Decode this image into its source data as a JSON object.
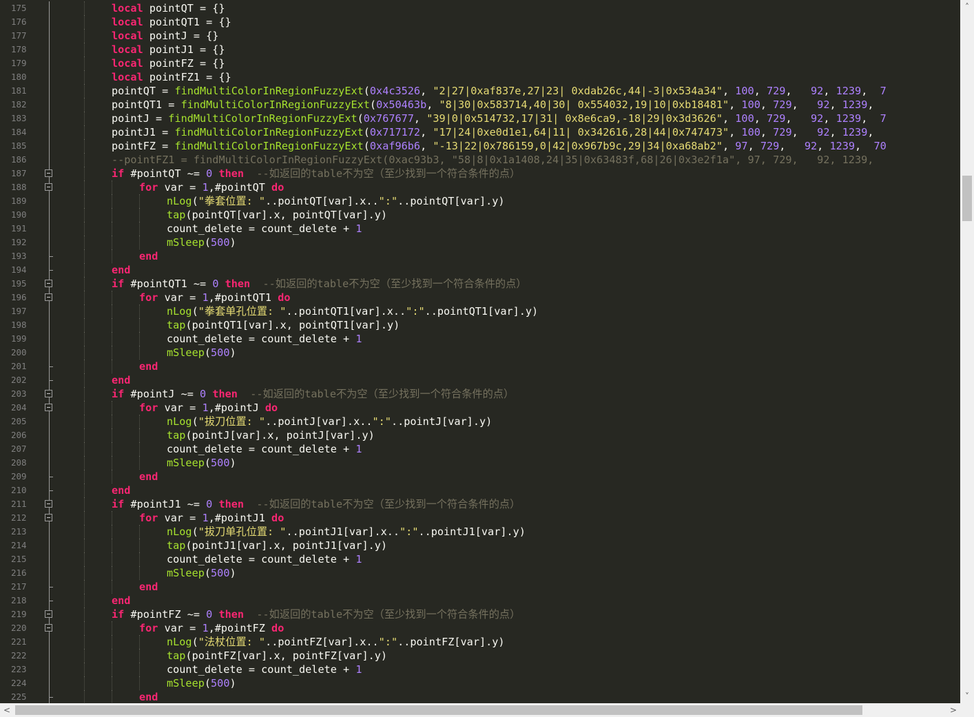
{
  "editor": {
    "first_line": 175,
    "lines": [
      {
        "indent": 2,
        "segs": [
          [
            "k",
            "local"
          ],
          [
            "t",
            " pointQT = {}"
          ]
        ]
      },
      {
        "indent": 2,
        "segs": [
          [
            "k",
            "local"
          ],
          [
            "t",
            " pointQT1 = {}"
          ]
        ]
      },
      {
        "indent": 2,
        "segs": [
          [
            "k",
            "local"
          ],
          [
            "t",
            " pointJ = {}"
          ]
        ]
      },
      {
        "indent": 2,
        "segs": [
          [
            "k",
            "local"
          ],
          [
            "t",
            " pointJ1 = {}"
          ]
        ]
      },
      {
        "indent": 2,
        "segs": [
          [
            "k",
            "local"
          ],
          [
            "t",
            " pointFZ = {}"
          ]
        ]
      },
      {
        "indent": 2,
        "segs": [
          [
            "k",
            "local"
          ],
          [
            "t",
            " pointFZ1 = {}"
          ]
        ]
      },
      {
        "indent": 2,
        "segs": [
          [
            "t",
            "pointQT = "
          ],
          [
            "b",
            "findMultiColorInRegionFuzzyExt"
          ],
          [
            "t",
            "("
          ],
          [
            "n",
            "0x4c3526"
          ],
          [
            "t",
            ", "
          ],
          [
            "s",
            "\"2|27|0xaf837e,27|23| 0xdab26c,44|-3|0x534a34\""
          ],
          [
            "t",
            ", "
          ],
          [
            "n",
            "100"
          ],
          [
            "t",
            ", "
          ],
          [
            "n",
            "729"
          ],
          [
            "t",
            ",   "
          ],
          [
            "n",
            "92"
          ],
          [
            "t",
            ", "
          ],
          [
            "n",
            "1239"
          ],
          [
            "t",
            ",  "
          ],
          [
            "n",
            "7"
          ]
        ]
      },
      {
        "indent": 2,
        "segs": [
          [
            "t",
            "pointQT1 = "
          ],
          [
            "b",
            "findMultiColorInRegionFuzzyExt"
          ],
          [
            "t",
            "("
          ],
          [
            "n",
            "0x50463b"
          ],
          [
            "t",
            ", "
          ],
          [
            "s",
            "\"8|30|0x583714,40|30| 0x554032,19|10|0xb18481\""
          ],
          [
            "t",
            ", "
          ],
          [
            "n",
            "100"
          ],
          [
            "t",
            ", "
          ],
          [
            "n",
            "729"
          ],
          [
            "t",
            ",   "
          ],
          [
            "n",
            "92"
          ],
          [
            "t",
            ", "
          ],
          [
            "n",
            "1239"
          ],
          [
            "t",
            ","
          ]
        ]
      },
      {
        "indent": 2,
        "segs": [
          [
            "t",
            "pointJ = "
          ],
          [
            "b",
            "findMultiColorInRegionFuzzyExt"
          ],
          [
            "t",
            "("
          ],
          [
            "n",
            "0x767677"
          ],
          [
            "t",
            ", "
          ],
          [
            "s",
            "\"39|0|0x514732,17|31| 0x8e6ca9,-18|29|0x3d3626\""
          ],
          [
            "t",
            ", "
          ],
          [
            "n",
            "100"
          ],
          [
            "t",
            ", "
          ],
          [
            "n",
            "729"
          ],
          [
            "t",
            ",   "
          ],
          [
            "n",
            "92"
          ],
          [
            "t",
            ", "
          ],
          [
            "n",
            "1239"
          ],
          [
            "t",
            ",  "
          ],
          [
            "n",
            "7"
          ]
        ]
      },
      {
        "indent": 2,
        "segs": [
          [
            "t",
            "pointJ1 = "
          ],
          [
            "b",
            "findMultiColorInRegionFuzzyExt"
          ],
          [
            "t",
            "("
          ],
          [
            "n",
            "0x717172"
          ],
          [
            "t",
            ", "
          ],
          [
            "s",
            "\"17|24|0xe0d1e1,64|11| 0x342616,28|44|0x747473\""
          ],
          [
            "t",
            ", "
          ],
          [
            "n",
            "100"
          ],
          [
            "t",
            ", "
          ],
          [
            "n",
            "729"
          ],
          [
            "t",
            ",   "
          ],
          [
            "n",
            "92"
          ],
          [
            "t",
            ", "
          ],
          [
            "n",
            "1239"
          ],
          [
            "t",
            ","
          ]
        ]
      },
      {
        "indent": 2,
        "segs": [
          [
            "t",
            "pointFZ = "
          ],
          [
            "b",
            "findMultiColorInRegionFuzzyExt"
          ],
          [
            "t",
            "("
          ],
          [
            "n",
            "0xaf96b6"
          ],
          [
            "t",
            ", "
          ],
          [
            "s",
            "\"-13|22|0x786159,0|42|0x967b9c,29|34|0xa68ab2\""
          ],
          [
            "t",
            ", "
          ],
          [
            "n",
            "97"
          ],
          [
            "t",
            ", "
          ],
          [
            "n",
            "729"
          ],
          [
            "t",
            ",   "
          ],
          [
            "n",
            "92"
          ],
          [
            "t",
            ", "
          ],
          [
            "n",
            "1239"
          ],
          [
            "t",
            ",  "
          ],
          [
            "n",
            "70"
          ]
        ]
      },
      {
        "indent": 2,
        "segs": [
          [
            "c",
            "--pointFZ1 = findMultiColorInRegionFuzzyExt(0xac93b3, \"58|8|0x1a1408,24|35|0x63483f,68|26|0x3e2f1a\", 97, 729,   92, 1239,"
          ]
        ]
      },
      {
        "indent": 2,
        "segs": [
          [
            "k",
            "if"
          ],
          [
            "t",
            " #pointQT ~= "
          ],
          [
            "n",
            "0"
          ],
          [
            "t",
            " "
          ],
          [
            "k",
            "then"
          ],
          [
            "t",
            "  "
          ],
          [
            "c",
            "--如返回的table不为空（至少找到一个符合条件的点）"
          ]
        ]
      },
      {
        "indent": 3,
        "segs": [
          [
            "k",
            "for"
          ],
          [
            "t",
            " var = "
          ],
          [
            "n",
            "1"
          ],
          [
            "t",
            ",#pointQT "
          ],
          [
            "k",
            "do"
          ]
        ]
      },
      {
        "indent": 4,
        "segs": [
          [
            "b",
            "nLog"
          ],
          [
            "t",
            "("
          ],
          [
            "s",
            "\"拳套位置: \""
          ],
          [
            "t",
            "..pointQT[var].x.."
          ],
          [
            "s",
            "\":\""
          ],
          [
            "t",
            "..pointQT[var].y)"
          ]
        ]
      },
      {
        "indent": 4,
        "segs": [
          [
            "b",
            "tap"
          ],
          [
            "t",
            "(pointQT[var].x, pointQT[var].y)"
          ]
        ]
      },
      {
        "indent": 4,
        "segs": [
          [
            "t",
            "count_delete = count_delete + "
          ],
          [
            "n",
            "1"
          ]
        ]
      },
      {
        "indent": 4,
        "segs": [
          [
            "b",
            "mSleep"
          ],
          [
            "t",
            "("
          ],
          [
            "n",
            "500"
          ],
          [
            "t",
            ")"
          ]
        ]
      },
      {
        "indent": 3,
        "segs": [
          [
            "k",
            "end"
          ]
        ]
      },
      {
        "indent": 2,
        "segs": [
          [
            "k",
            "end"
          ]
        ]
      },
      {
        "indent": 2,
        "segs": [
          [
            "k",
            "if"
          ],
          [
            "t",
            " #pointQT1 ~= "
          ],
          [
            "n",
            "0"
          ],
          [
            "t",
            " "
          ],
          [
            "k",
            "then"
          ],
          [
            "t",
            "  "
          ],
          [
            "c",
            "--如返回的table不为空（至少找到一个符合条件的点）"
          ]
        ]
      },
      {
        "indent": 3,
        "segs": [
          [
            "k",
            "for"
          ],
          [
            "t",
            " var = "
          ],
          [
            "n",
            "1"
          ],
          [
            "t",
            ",#pointQT1 "
          ],
          [
            "k",
            "do"
          ]
        ]
      },
      {
        "indent": 4,
        "segs": [
          [
            "b",
            "nLog"
          ],
          [
            "t",
            "("
          ],
          [
            "s",
            "\"拳套单孔位置: \""
          ],
          [
            "t",
            "..pointQT1[var].x.."
          ],
          [
            "s",
            "\":\""
          ],
          [
            "t",
            "..pointQT1[var].y)"
          ]
        ]
      },
      {
        "indent": 4,
        "segs": [
          [
            "b",
            "tap"
          ],
          [
            "t",
            "(pointQT1[var].x, pointQT1[var].y)"
          ]
        ]
      },
      {
        "indent": 4,
        "segs": [
          [
            "t",
            "count_delete = count_delete + "
          ],
          [
            "n",
            "1"
          ]
        ]
      },
      {
        "indent": 4,
        "segs": [
          [
            "b",
            "mSleep"
          ],
          [
            "t",
            "("
          ],
          [
            "n",
            "500"
          ],
          [
            "t",
            ")"
          ]
        ]
      },
      {
        "indent": 3,
        "segs": [
          [
            "k",
            "end"
          ]
        ]
      },
      {
        "indent": 2,
        "segs": [
          [
            "k",
            "end"
          ]
        ]
      },
      {
        "indent": 2,
        "segs": [
          [
            "k",
            "if"
          ],
          [
            "t",
            " #pointJ ~= "
          ],
          [
            "n",
            "0"
          ],
          [
            "t",
            " "
          ],
          [
            "k",
            "then"
          ],
          [
            "t",
            "  "
          ],
          [
            "c",
            "--如返回的table不为空（至少找到一个符合条件的点）"
          ]
        ]
      },
      {
        "indent": 3,
        "segs": [
          [
            "k",
            "for"
          ],
          [
            "t",
            " var = "
          ],
          [
            "n",
            "1"
          ],
          [
            "t",
            ",#pointJ "
          ],
          [
            "k",
            "do"
          ]
        ]
      },
      {
        "indent": 4,
        "segs": [
          [
            "b",
            "nLog"
          ],
          [
            "t",
            "("
          ],
          [
            "s",
            "\"拔刀位置: \""
          ],
          [
            "t",
            "..pointJ[var].x.."
          ],
          [
            "s",
            "\":\""
          ],
          [
            "t",
            "..pointJ[var].y)"
          ]
        ]
      },
      {
        "indent": 4,
        "segs": [
          [
            "b",
            "tap"
          ],
          [
            "t",
            "(pointJ[var].x, pointJ[var].y)"
          ]
        ]
      },
      {
        "indent": 4,
        "segs": [
          [
            "t",
            "count_delete = count_delete + "
          ],
          [
            "n",
            "1"
          ]
        ]
      },
      {
        "indent": 4,
        "segs": [
          [
            "b",
            "mSleep"
          ],
          [
            "t",
            "("
          ],
          [
            "n",
            "500"
          ],
          [
            "t",
            ")"
          ]
        ]
      },
      {
        "indent": 3,
        "segs": [
          [
            "k",
            "end"
          ]
        ]
      },
      {
        "indent": 2,
        "segs": [
          [
            "k",
            "end"
          ]
        ]
      },
      {
        "indent": 2,
        "segs": [
          [
            "k",
            "if"
          ],
          [
            "t",
            " #pointJ1 ~= "
          ],
          [
            "n",
            "0"
          ],
          [
            "t",
            " "
          ],
          [
            "k",
            "then"
          ],
          [
            "t",
            "  "
          ],
          [
            "c",
            "--如返回的table不为空（至少找到一个符合条件的点）"
          ]
        ]
      },
      {
        "indent": 3,
        "segs": [
          [
            "k",
            "for"
          ],
          [
            "t",
            " var = "
          ],
          [
            "n",
            "1"
          ],
          [
            "t",
            ",#pointJ1 "
          ],
          [
            "k",
            "do"
          ]
        ]
      },
      {
        "indent": 4,
        "segs": [
          [
            "b",
            "nLog"
          ],
          [
            "t",
            "("
          ],
          [
            "s",
            "\"拔刀单孔位置: \""
          ],
          [
            "t",
            "..pointJ1[var].x.."
          ],
          [
            "s",
            "\":\""
          ],
          [
            "t",
            "..pointJ1[var].y)"
          ]
        ]
      },
      {
        "indent": 4,
        "segs": [
          [
            "b",
            "tap"
          ],
          [
            "t",
            "(pointJ1[var].x, pointJ1[var].y)"
          ]
        ]
      },
      {
        "indent": 4,
        "segs": [
          [
            "t",
            "count_delete = count_delete + "
          ],
          [
            "n",
            "1"
          ]
        ]
      },
      {
        "indent": 4,
        "segs": [
          [
            "b",
            "mSleep"
          ],
          [
            "t",
            "("
          ],
          [
            "n",
            "500"
          ],
          [
            "t",
            ")"
          ]
        ]
      },
      {
        "indent": 3,
        "segs": [
          [
            "k",
            "end"
          ]
        ]
      },
      {
        "indent": 2,
        "segs": [
          [
            "k",
            "end"
          ]
        ]
      },
      {
        "indent": 2,
        "segs": [
          [
            "k",
            "if"
          ],
          [
            "t",
            " #pointFZ ~= "
          ],
          [
            "n",
            "0"
          ],
          [
            "t",
            " "
          ],
          [
            "k",
            "then"
          ],
          [
            "t",
            "  "
          ],
          [
            "c",
            "--如返回的table不为空（至少找到一个符合条件的点）"
          ]
        ]
      },
      {
        "indent": 3,
        "segs": [
          [
            "k",
            "for"
          ],
          [
            "t",
            " var = "
          ],
          [
            "n",
            "1"
          ],
          [
            "t",
            ",#pointFZ "
          ],
          [
            "k",
            "do"
          ]
        ]
      },
      {
        "indent": 4,
        "segs": [
          [
            "b",
            "nLog"
          ],
          [
            "t",
            "("
          ],
          [
            "s",
            "\"法杖位置: \""
          ],
          [
            "t",
            "..pointFZ[var].x.."
          ],
          [
            "s",
            "\":\""
          ],
          [
            "t",
            "..pointFZ[var].y)"
          ]
        ]
      },
      {
        "indent": 4,
        "segs": [
          [
            "b",
            "tap"
          ],
          [
            "t",
            "(pointFZ[var].x, pointFZ[var].y)"
          ]
        ]
      },
      {
        "indent": 4,
        "segs": [
          [
            "t",
            "count_delete = count_delete + "
          ],
          [
            "n",
            "1"
          ]
        ]
      },
      {
        "indent": 4,
        "segs": [
          [
            "b",
            "mSleep"
          ],
          [
            "t",
            "("
          ],
          [
            "n",
            "500"
          ],
          [
            "t",
            ")"
          ]
        ]
      },
      {
        "indent": 3,
        "segs": [
          [
            "k",
            "end"
          ]
        ]
      }
    ],
    "fold_open_lines": [
      187,
      188,
      195,
      196,
      203,
      204,
      211,
      212,
      219,
      220
    ],
    "fold_end_lines": [
      193,
      194,
      201,
      202,
      209,
      210,
      217,
      218,
      225
    ]
  },
  "scrollbars": {
    "up_arrow": "˄",
    "down_arrow": "˅",
    "left_arrow": "<",
    "right_arrow": ">"
  },
  "colors": {
    "background": "#272822",
    "keyword": "#f92672",
    "builtin": "#a6e22e",
    "number": "#ae81ff",
    "string": "#e6db74",
    "comment": "#75715e",
    "text": "#f8f8f2"
  }
}
